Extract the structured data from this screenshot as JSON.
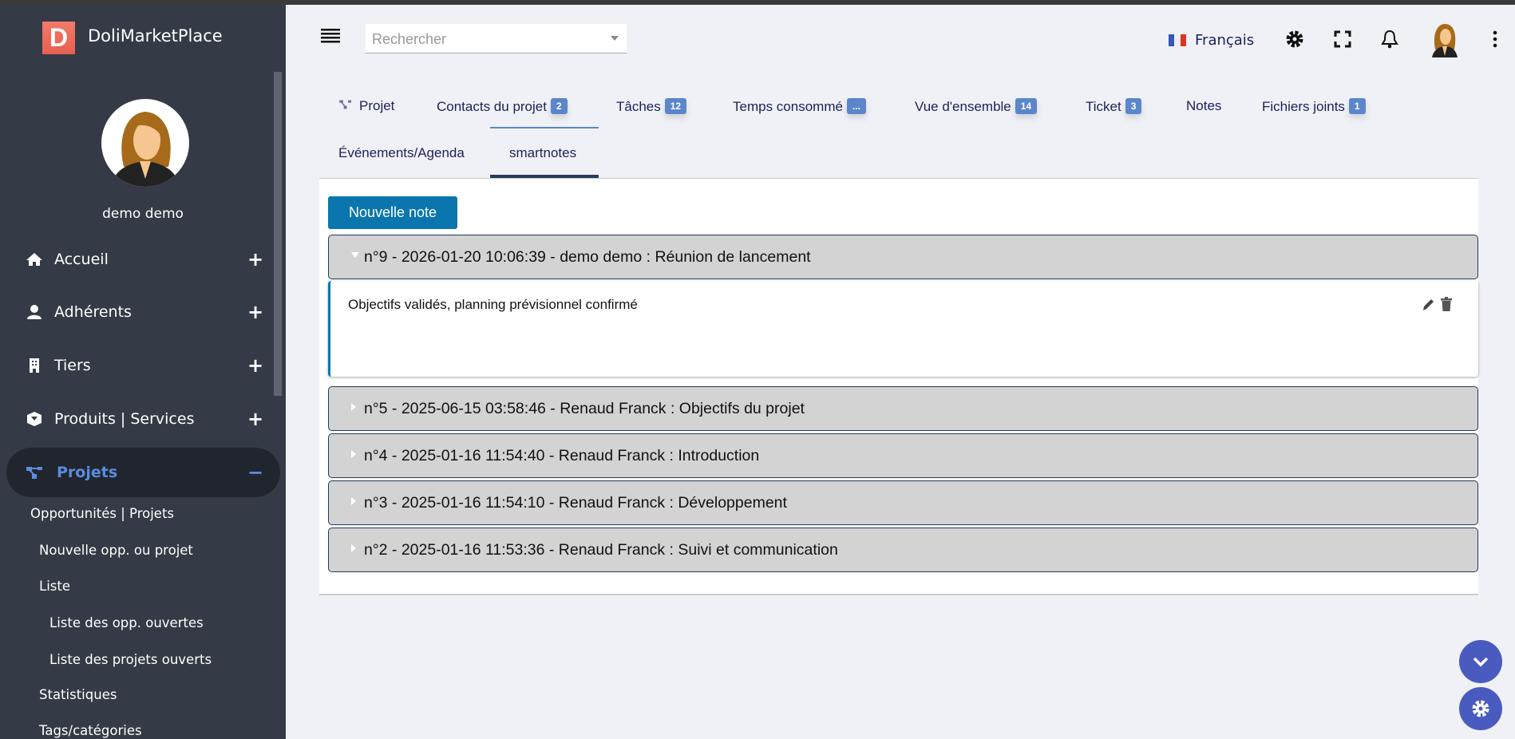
{
  "app": {
    "logo_letter": "D",
    "name": "DoliMarketPlace",
    "user": "demo demo"
  },
  "sidebar": {
    "items": [
      {
        "label": "Accueil",
        "icon": "home-icon",
        "toggle": "+"
      },
      {
        "label": "Adhérents",
        "icon": "user-icon",
        "toggle": "+"
      },
      {
        "label": "Tiers",
        "icon": "building-icon",
        "toggle": "+"
      },
      {
        "label": "Produits | Services",
        "icon": "box-icon",
        "toggle": "+"
      },
      {
        "label": "Projets",
        "icon": "project-icon",
        "toggle": "−"
      }
    ],
    "subitems": [
      "Opportunités | Projets",
      "Nouvelle opp. ou projet",
      "Liste",
      "Liste des opp. ouvertes",
      "Liste des projets ouverts",
      "Statistiques",
      "Tags/catégories"
    ]
  },
  "header": {
    "search_placeholder": "Rechercher",
    "language": "Français"
  },
  "tabs": [
    {
      "label": "Projet"
    },
    {
      "label": "Contacts du projet",
      "badge": "2"
    },
    {
      "label": "Tâches",
      "badge": "12"
    },
    {
      "label": "Temps consommé",
      "badge": "..."
    },
    {
      "label": "Vue d'ensemble",
      "badge": "14"
    },
    {
      "label": "Ticket",
      "badge": "3"
    },
    {
      "label": "Notes"
    },
    {
      "label": "Fichiers joints",
      "badge": "1"
    },
    {
      "label": "Événements/Agenda"
    },
    {
      "label": "smartnotes",
      "active": true
    }
  ],
  "notes": {
    "new_label": "Nouvelle note",
    "items": [
      {
        "title": "n°9 - 2026-01-20 10:06:39 - demo demo : Réunion de lancement",
        "expanded": true,
        "body": "Objectifs validés, planning prévisionnel confirmé"
      },
      {
        "title": "n°5 - 2025-06-15 03:58:46 - Renaud Franck : Objectifs du projet"
      },
      {
        "title": "n°4 - 2025-01-16 11:54:40 - Renaud Franck : Introduction"
      },
      {
        "title": "n°3 - 2025-01-16 11:54:10 - Renaud Franck : Développement"
      },
      {
        "title": "n°2 - 2025-01-16 11:53:36 - Renaud Franck : Suivi et communication"
      }
    ]
  },
  "colors": {
    "sidebar": "#343a46",
    "accent": "#0b76ad",
    "badge": "#5b86c9",
    "active_menu": "#5a8ce0"
  }
}
